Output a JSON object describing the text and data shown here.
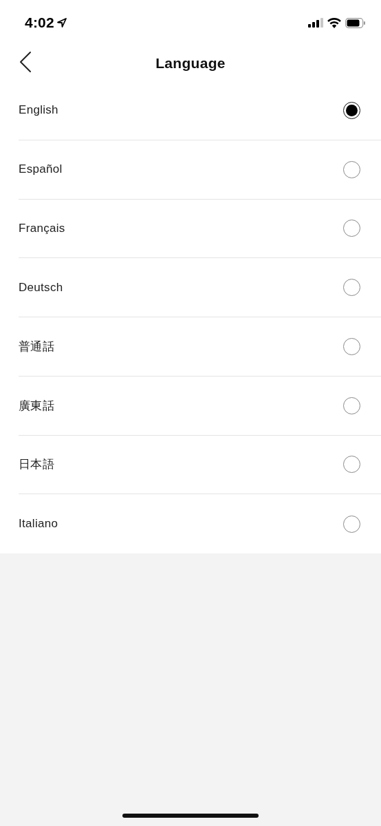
{
  "status_bar": {
    "time": "4:02"
  },
  "nav": {
    "title": "Language"
  },
  "languages": [
    {
      "label": "English",
      "selected": true
    },
    {
      "label": "Español",
      "selected": false
    },
    {
      "label": "Français",
      "selected": false
    },
    {
      "label": "Deutsch",
      "selected": false
    },
    {
      "label": "普通話",
      "selected": false
    },
    {
      "label": "廣東話",
      "selected": false
    },
    {
      "label": "日本語",
      "selected": false
    },
    {
      "label": "Italiano",
      "selected": false
    }
  ]
}
